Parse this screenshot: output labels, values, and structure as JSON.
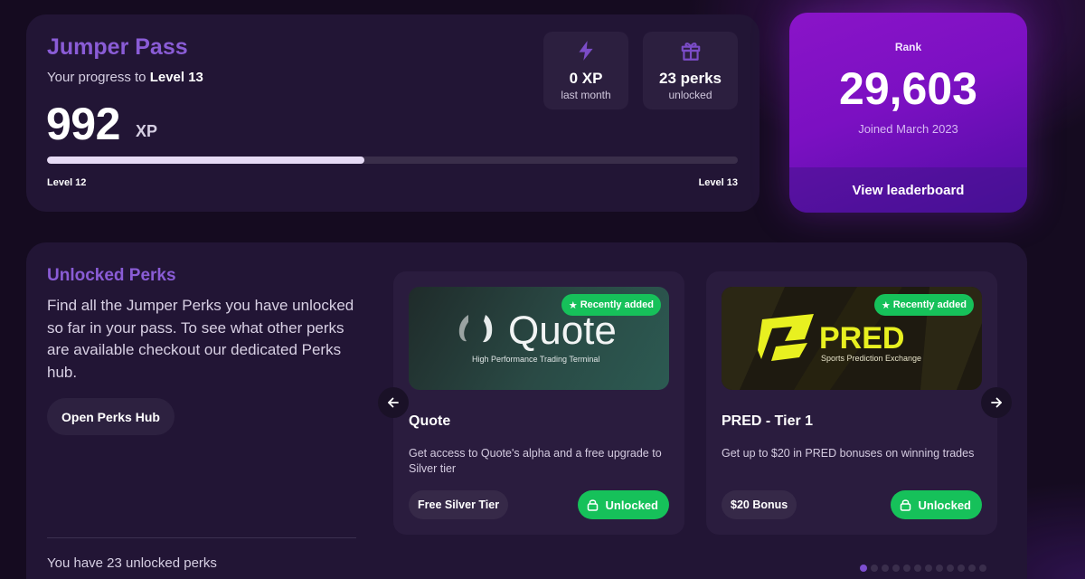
{
  "pass": {
    "title": "Jumper Pass",
    "progress_prefix": "Your progress to ",
    "progress_target": "Level 13",
    "xp_value": "992",
    "xp_unit": "XP",
    "progress_fraction": 0.46,
    "level_start": "Level 12",
    "level_end": "Level 13",
    "stats": [
      {
        "icon": "lightning-icon",
        "value": "0 XP",
        "label": "last month"
      },
      {
        "icon": "gift-icon",
        "value": "23 perks",
        "label": "unlocked"
      }
    ]
  },
  "rank": {
    "label": "Rank",
    "value": "29,603",
    "joined": "Joined March 2023",
    "button_label": "View leaderboard"
  },
  "perks": {
    "title": "Unlocked Perks",
    "description": "Find all the Jumper Perks you have unlocked so far in your pass. To see what other perks are available checkout our dedicated Perks hub.",
    "hub_button": "Open Perks Hub",
    "count_text": "You have 23 unlocked perks",
    "total_dots": 12,
    "active_dot": 0,
    "items": [
      {
        "badge": "Recently added",
        "banner_logo": "Quote",
        "banner_tagline": "High Performance Trading Terminal",
        "name": "Quote",
        "description": "Get access to Quote's alpha and a free upgrade to Silver tier",
        "tag": "Free Silver Tier",
        "status": "Unlocked"
      },
      {
        "badge": "Recently added",
        "banner_logo": "PRED",
        "banner_tagline": "Sports Prediction Exchange",
        "name": "PRED - Tier 1",
        "description": "Get up to $20 in PRED bonuses on winning trades",
        "tag": "$20 Bonus",
        "status": "Unlocked"
      }
    ]
  },
  "colors": {
    "background": "#150b20",
    "card": "#221535",
    "accent_purple": "#8a5cd6",
    "rank_gradient_start": "#8a14c8",
    "success_green": "#16c15a",
    "pred_yellow": "#e8f020"
  }
}
